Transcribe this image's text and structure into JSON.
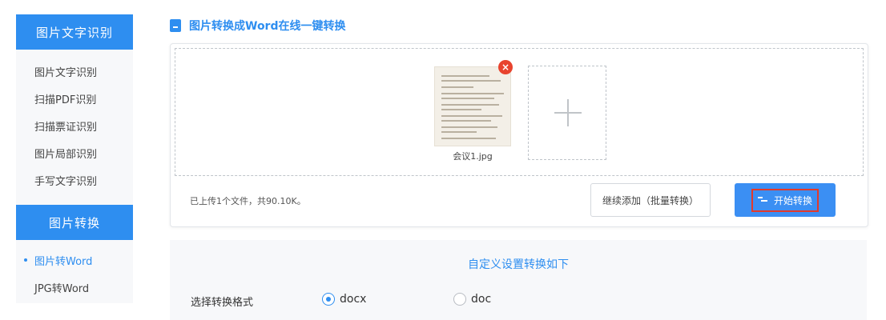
{
  "sidebar": {
    "section1_title": "图片文字识别",
    "section1_items": [
      "图片文字识别",
      "扫描PDF识别",
      "扫描票证识别",
      "图片局部识别",
      "手写文字识别"
    ],
    "section2_title": "图片转换",
    "section2_items": [
      "图片转Word",
      "JPG转Word"
    ],
    "active_item": "图片转Word"
  },
  "page_title": "图片转换成Word在线一键转换",
  "upload": {
    "file_name": "会议1.jpg",
    "status_text": "已上传1个文件，共90.10K。",
    "continue_button": "继续添加（批量转换）",
    "start_button": "开始转换"
  },
  "settings": {
    "title": "自定义设置转换如下",
    "format_label": "选择转换格式",
    "options": [
      "docx",
      "doc"
    ],
    "selected": "docx"
  },
  "colors": {
    "accent": "#2e8ef0",
    "button": "#3b8ff3",
    "close": "#e8432e",
    "highlight_border": "#e33a2b"
  },
  "icons": {
    "title": "document-icon",
    "thumb_close": "close-icon",
    "add": "plus-icon",
    "start": "convert-icon"
  }
}
